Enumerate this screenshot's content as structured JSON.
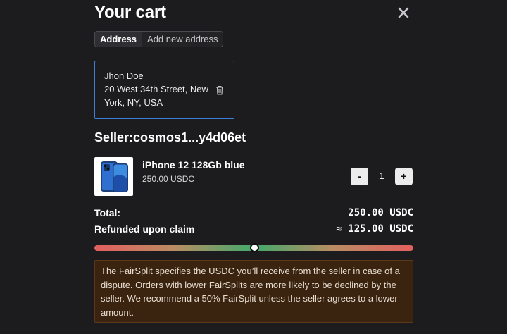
{
  "cart": {
    "title": "Your cart",
    "close_icon": "close-icon",
    "tabs": [
      {
        "label": "Address",
        "active": true
      },
      {
        "label": "Add new address",
        "active": false
      }
    ],
    "address": {
      "lines": [
        "Jhon Doe",
        "20 West 34th Street, New",
        "York, NY, USA"
      ],
      "delete_icon": "trash-icon"
    },
    "seller_label": "Seller:cosmos1...y4d06et",
    "item": {
      "name": "iPhone 12 128Gb blue",
      "price": "250.00 USDC",
      "quantity": "1",
      "minus_label": "-",
      "plus_label": "+",
      "image_icon": "phone-image"
    },
    "total_label": "Total:",
    "total_value": "250.00 USDC",
    "refund_label": "Refunded upon claim",
    "refund_value": "≈ 125.00 USDC",
    "fairsplit_percent": 50,
    "info_text": "The FairSplit specifies the USDC you’ll receive from the seller in case of a dispute. Orders with lower FairSplits are more likely to be declined by the seller. We recommend a 50% FairSplit unless the seller agrees to a lower amount."
  },
  "colors": {
    "background": "#1c1c1e",
    "address_border": "#3d7fd6",
    "slider_red": "#e35f5f",
    "slider_green": "#43a96c",
    "info_bg": "#3a2410"
  }
}
